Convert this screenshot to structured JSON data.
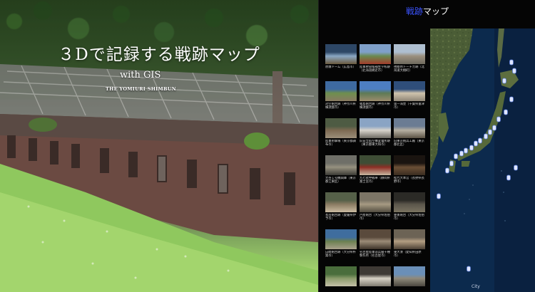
{
  "hero": {
    "title": "３Dで記録する戦跡マップ",
    "subtitle": "with GIS",
    "brand": "THE YOMIURI SHIMBUN"
  },
  "panel": {
    "title_accent": "戦跡",
    "title_rest": "マップ"
  },
  "sites": [
    {
      "caption": "原爆ドーム（広島市）",
      "thumb": [
        "#2d4766",
        "#8aa7c4",
        "#6b5a3e"
      ]
    },
    {
      "caption": "陸軍幹部候補生学校跡（北海道網走市）",
      "thumb": [
        "#7fa0c9",
        "#6a8a4f",
        "#a33c2c"
      ]
    },
    {
      "caption": "視察用トーチカ跡（北海道大樹町）",
      "thumb": [
        "#aebfd0",
        "#9a8f7e",
        "#6e6a5e"
      ]
    },
    {
      "caption": "対空砲台跡（神奈川県横須賀市）",
      "thumb": [
        "#3e6aa0",
        "#6e8f4e",
        "#8a7a63"
      ]
    },
    {
      "caption": "猿島砲台跡（神奈川県横須賀市）",
      "thumb": [
        "#4d7ec2",
        "#5e7a55",
        "#9c8c6e"
      ]
    },
    {
      "caption": "第一海堡（千葉県富津市）",
      "thumb": [
        "#2f4e7a",
        "#cfc3ad",
        "#8d8576"
      ]
    },
    {
      "caption": "陸軍射撃場（東京都調布市）",
      "thumb": [
        "#4e5b43",
        "#7d6a52",
        "#9b8e7a"
      ]
    },
    {
      "caption": "旧日立航空機変電所跡（東京都東大和市）",
      "thumb": [
        "#8aa4c4",
        "#d8d4cc",
        "#6d6a62"
      ]
    },
    {
      "caption": "旧東京砲兵工廠（東京都北区）",
      "thumb": [
        "#6b7c93",
        "#b7b0a2",
        "#5a5244"
      ]
    },
    {
      "caption": "大谷１号機関庫（東京都江東区）",
      "thumb": [
        "#6f6f68",
        "#96917f",
        "#3b3a35"
      ]
    },
    {
      "caption": "九七式中戦車（静岡県富士宮市）",
      "thumb": [
        "#3e4d35",
        "#8c2f25",
        "#c7b7a1"
      ]
    },
    {
      "caption": "松代大本営（長野県長野市）",
      "thumb": [
        "#1a1410",
        "#6b4f36",
        "#3a2c20"
      ]
    },
    {
      "caption": "長岳砲台跡（愛媛県伊予市）",
      "thumb": [
        "#556048",
        "#8a7b62",
        "#c9baa0"
      ]
    },
    {
      "caption": "芦屋砲台（大分県佐伯市）",
      "thumb": [
        "#7c7566",
        "#a69a82",
        "#514b40"
      ]
    },
    {
      "caption": "豊後砲台（大分県佐伯市）",
      "thumb": [
        "#2b2a26",
        "#5b564b",
        "#7a7360"
      ]
    },
    {
      "caption": "白崎砲台跡（大分県杵築市）",
      "thumb": [
        "#3f6d9e",
        "#6b8050",
        "#a9a08b"
      ]
    },
    {
      "caption": "名古屋陸軍造兵廠千種製作所（名古屋市）",
      "thumb": [
        "#5a4a3c",
        "#9b8b77",
        "#3c3228"
      ]
    },
    {
      "caption": "東大湊（愛知県田原市）",
      "thumb": [
        "#6c6355",
        "#b39e82",
        "#4a3f33"
      ]
    },
    {
      "caption": "",
      "thumb": [
        "#4a6d3c",
        "#8a9b6a",
        "#c4c0a8"
      ]
    },
    {
      "caption": "",
      "thumb": [
        "#3e3a35",
        "#d7d2c6",
        "#7f7a70"
      ]
    },
    {
      "caption": "",
      "thumb": [
        "#6a8fb8",
        "#8f8a7c",
        "#4b4740"
      ]
    }
  ],
  "map": {
    "city_label": "City",
    "land_color": "#3c4f2e",
    "sea_color": "#0d2a4c",
    "marker_color": "#dfe6ff"
  }
}
